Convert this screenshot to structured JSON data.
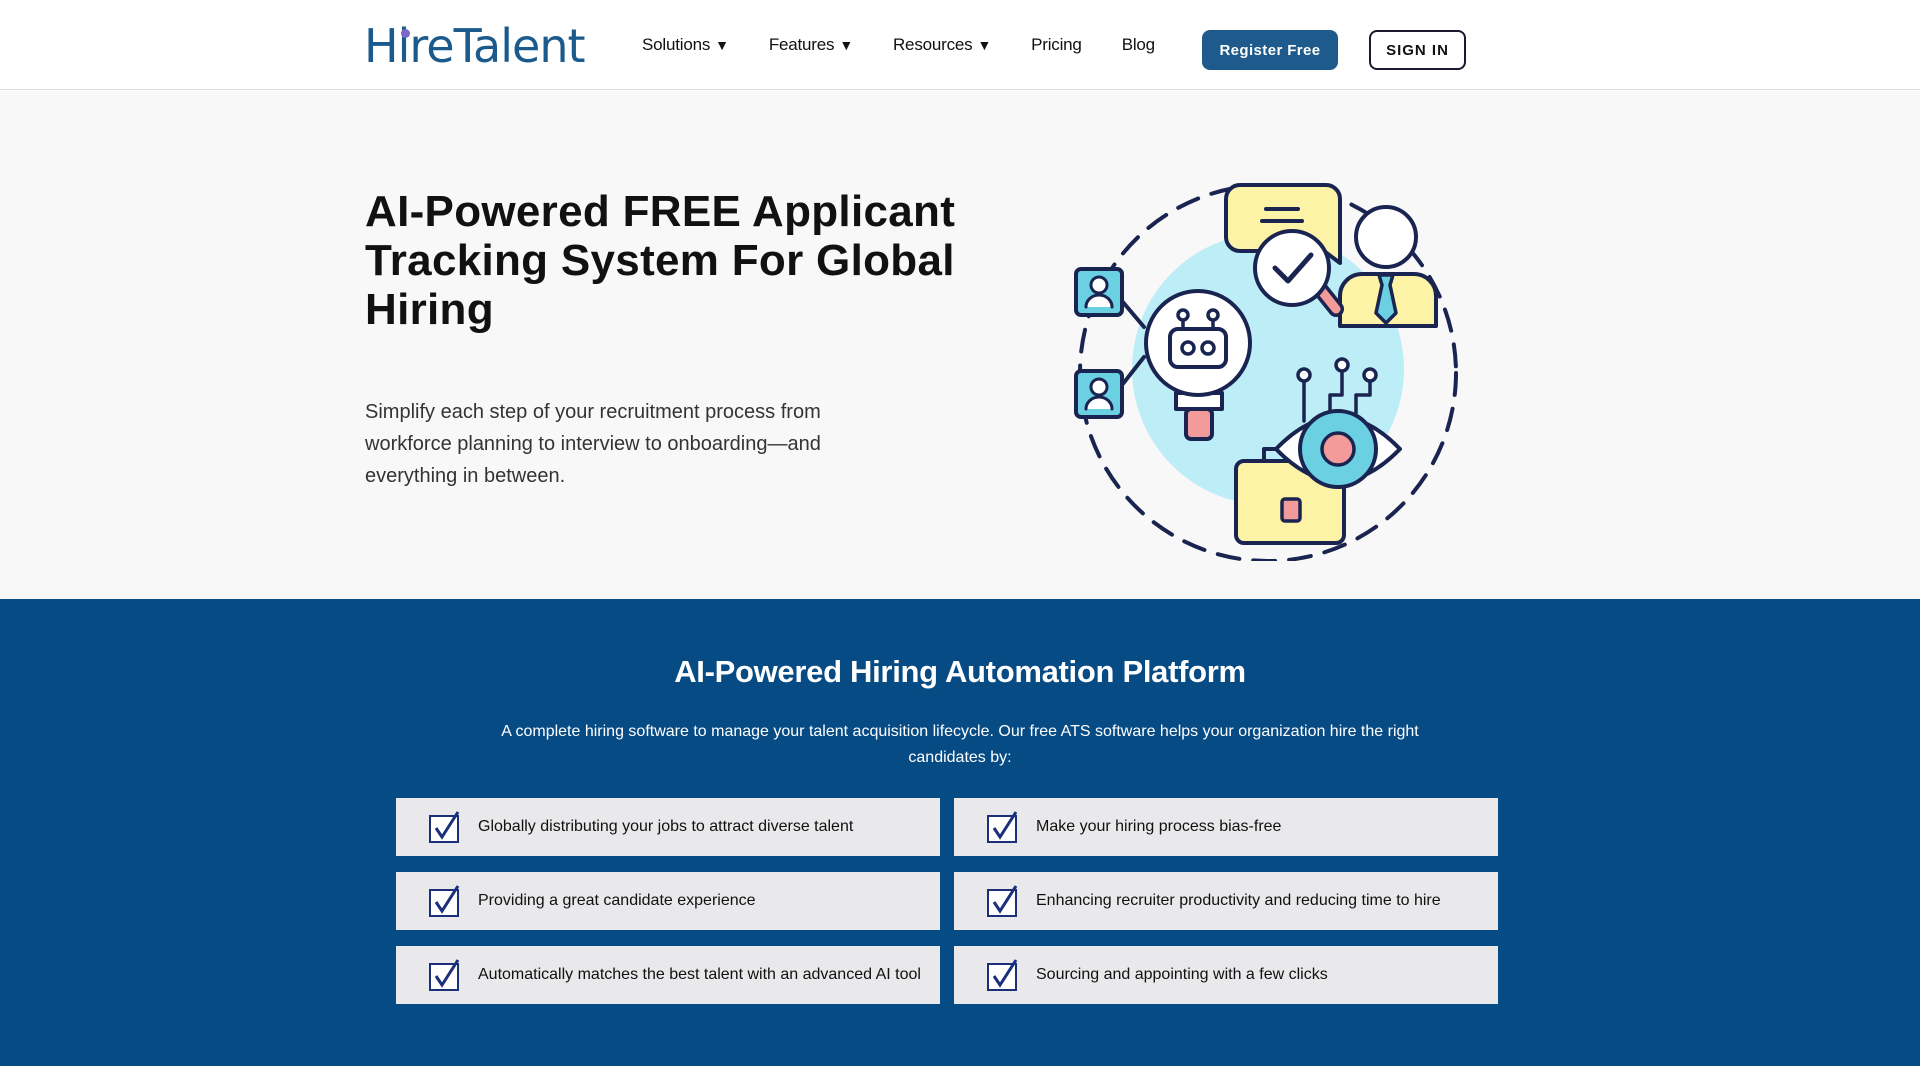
{
  "header": {
    "logo_text": "HireTalent",
    "nav": [
      {
        "label": "Solutions",
        "caret": "▼"
      },
      {
        "label": "Features",
        "caret": "▼"
      },
      {
        "label": "Resources",
        "caret": "▼"
      },
      {
        "label": "Pricing",
        "caret": ""
      },
      {
        "label": "Blog",
        "caret": ""
      }
    ],
    "register_label": "Register Free",
    "signin_label": "SIGN IN"
  },
  "hero": {
    "title": "AI-Powered FREE Applicant Tracking System For Global Hiring",
    "subtitle": "Simplify each step of your recruitment process from workforce planning to interview to onboarding—and everything in between."
  },
  "platform": {
    "title": "AI-Powered Hiring Automation Platform",
    "description": "A complete hiring software to manage your talent acquisition lifecycle. Our free ATS software helps your organization hire the right candidates by:",
    "features": [
      "Globally distributing your jobs to attract diverse talent",
      "Make your hiring process bias-free",
      "Providing a great candidate experience",
      "Enhancing recruiter productivity and reducing time to hire",
      "Automatically matches the best talent with an advanced AI tool",
      "Sourcing and appointing with a few clicks"
    ]
  },
  "colors": {
    "brand_blue": "#1e5a8c",
    "section_blue": "#074b85",
    "feature_card": "#e9e8ea",
    "illustration_cyan": "#bdeef8",
    "illustration_yellow": "#fdf3a6",
    "illustration_pink": "#f39a9a"
  },
  "icons": [
    "logo",
    "caret-down-icon",
    "checkbox-check-icon",
    "hiring-illustration"
  ]
}
